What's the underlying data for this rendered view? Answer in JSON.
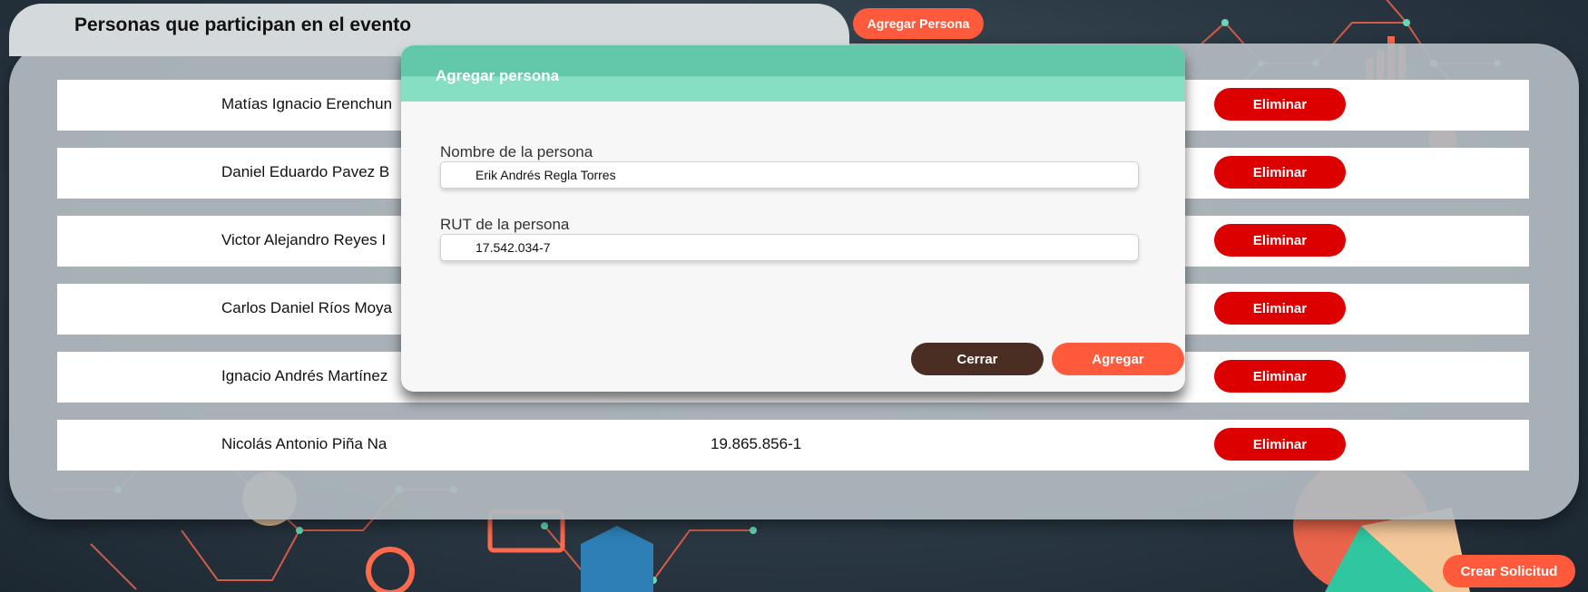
{
  "page": {
    "title": "Personas que participan en el evento",
    "add_button": "Agregar Persona",
    "create_request_button": "Crear Solicitud"
  },
  "persons": [
    {
      "name": "Matías Ignacio Erenchun",
      "rut": "",
      "delete_label": "Eliminar"
    },
    {
      "name": "Daniel Eduardo Pavez B",
      "rut": "",
      "delete_label": "Eliminar"
    },
    {
      "name": "Victor Alejandro Reyes I",
      "rut": "",
      "delete_label": "Eliminar"
    },
    {
      "name": "Carlos Daniel Ríos Moya",
      "rut": "",
      "delete_label": "Eliminar"
    },
    {
      "name": "Ignacio Andrés Martínez",
      "rut": "",
      "delete_label": "Eliminar"
    },
    {
      "name": "Nicolás Antonio Piña Na",
      "rut": "19.865.856-1",
      "delete_label": "Eliminar"
    }
  ],
  "modal": {
    "title": "Agregar persona",
    "name_label": "Nombre de la persona",
    "name_value": "Erik Andrés Regla Torres",
    "rut_label": "RUT de la persona",
    "rut_value": "17.542.034-7",
    "close_button": "Cerrar",
    "add_button": "Agregar"
  },
  "colors": {
    "accent": "#ff5a3c",
    "danger": "#dc0000",
    "modal_header": "#62c8a9",
    "close_button": "#4a2e23"
  }
}
